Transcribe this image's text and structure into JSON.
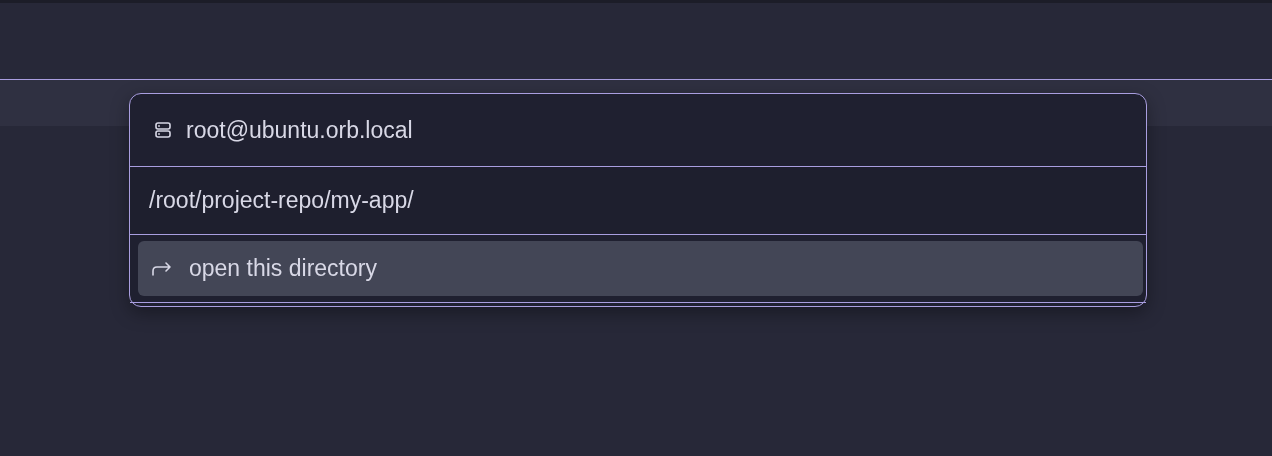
{
  "popup": {
    "host": "root@ubuntu.orb.local",
    "path_field": {
      "value": "/root/project-repo/my-app/"
    },
    "items": [
      {
        "label": "open this directory",
        "selected": true
      }
    ]
  }
}
